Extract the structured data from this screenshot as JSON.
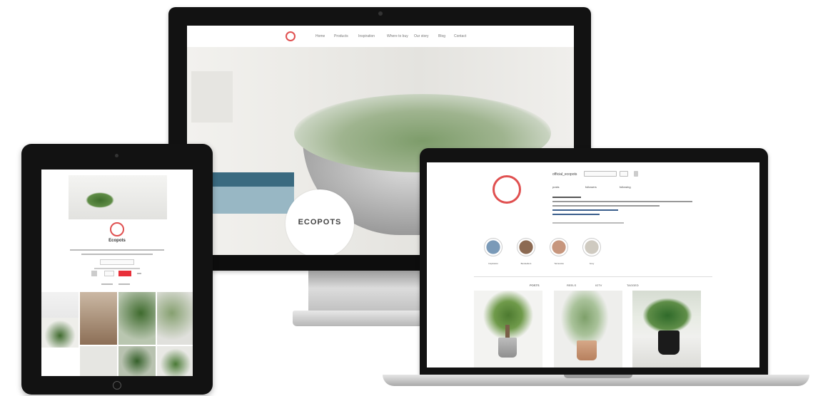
{
  "desktop": {
    "nav_items": [
      "Home",
      "Products",
      "Inspiration",
      "Where to buy",
      "Our story",
      "Blog",
      "Contact"
    ],
    "hero_brand": "ECOPOTS"
  },
  "tablet": {
    "profile_name": "Ecopots",
    "follow_label": "Follow",
    "message_label": "Message"
  },
  "laptop": {
    "username": "official_ecopots",
    "follow_label": "Follow",
    "stats": [
      "posts",
      "followers",
      "following"
    ],
    "highlights": [
      {
        "label": "Inspiration",
        "color": "#7a9ab8"
      },
      {
        "label": "Bestsellers",
        "color": "#8c6a52"
      },
      {
        "label": "Terracotta",
        "color": "#c7967d"
      },
      {
        "label": "Grey",
        "color": "#cfcac0"
      }
    ],
    "tabs": [
      "POSTS",
      "REELS",
      "IGTV",
      "TAGGED"
    ]
  },
  "colors": {
    "brand_red": "#e05050",
    "device_black": "#121212"
  }
}
